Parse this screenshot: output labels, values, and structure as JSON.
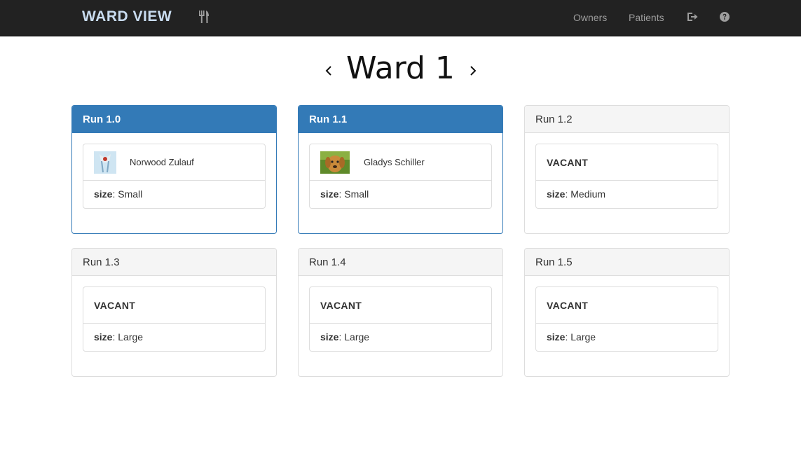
{
  "navbar": {
    "brand": "WARD VIEW",
    "owners_label": "Owners",
    "patients_label": "Patients",
    "icons": [
      "cutlery-icon",
      "logout-icon",
      "help-icon"
    ]
  },
  "ward": {
    "title": "Ward 1"
  },
  "runs": [
    {
      "label": "Run 1.0",
      "occupied": true,
      "patient": "Norwood Zulauf",
      "size_key": "size",
      "size_value": ": Small"
    },
    {
      "label": "Run 1.1",
      "occupied": true,
      "patient": "Gladys Schiller",
      "size_key": "size",
      "size_value": ": Small"
    },
    {
      "label": "Run 1.2",
      "occupied": false,
      "vacant_label": "VACANT",
      "size_key": "size",
      "size_value": ": Medium"
    },
    {
      "label": "Run 1.3",
      "occupied": false,
      "vacant_label": "VACANT",
      "size_key": "size",
      "size_value": ": Large"
    },
    {
      "label": "Run 1.4",
      "occupied": false,
      "vacant_label": "VACANT",
      "size_key": "size",
      "size_value": ": Large"
    },
    {
      "label": "Run 1.5",
      "occupied": false,
      "vacant_label": "VACANT",
      "size_key": "size",
      "size_value": ": Large"
    }
  ],
  "colors": {
    "navbar_bg": "#222222",
    "brand": "#c9dcf0",
    "primary": "#337ab7",
    "panel_heading_bg": "#f5f5f5"
  }
}
